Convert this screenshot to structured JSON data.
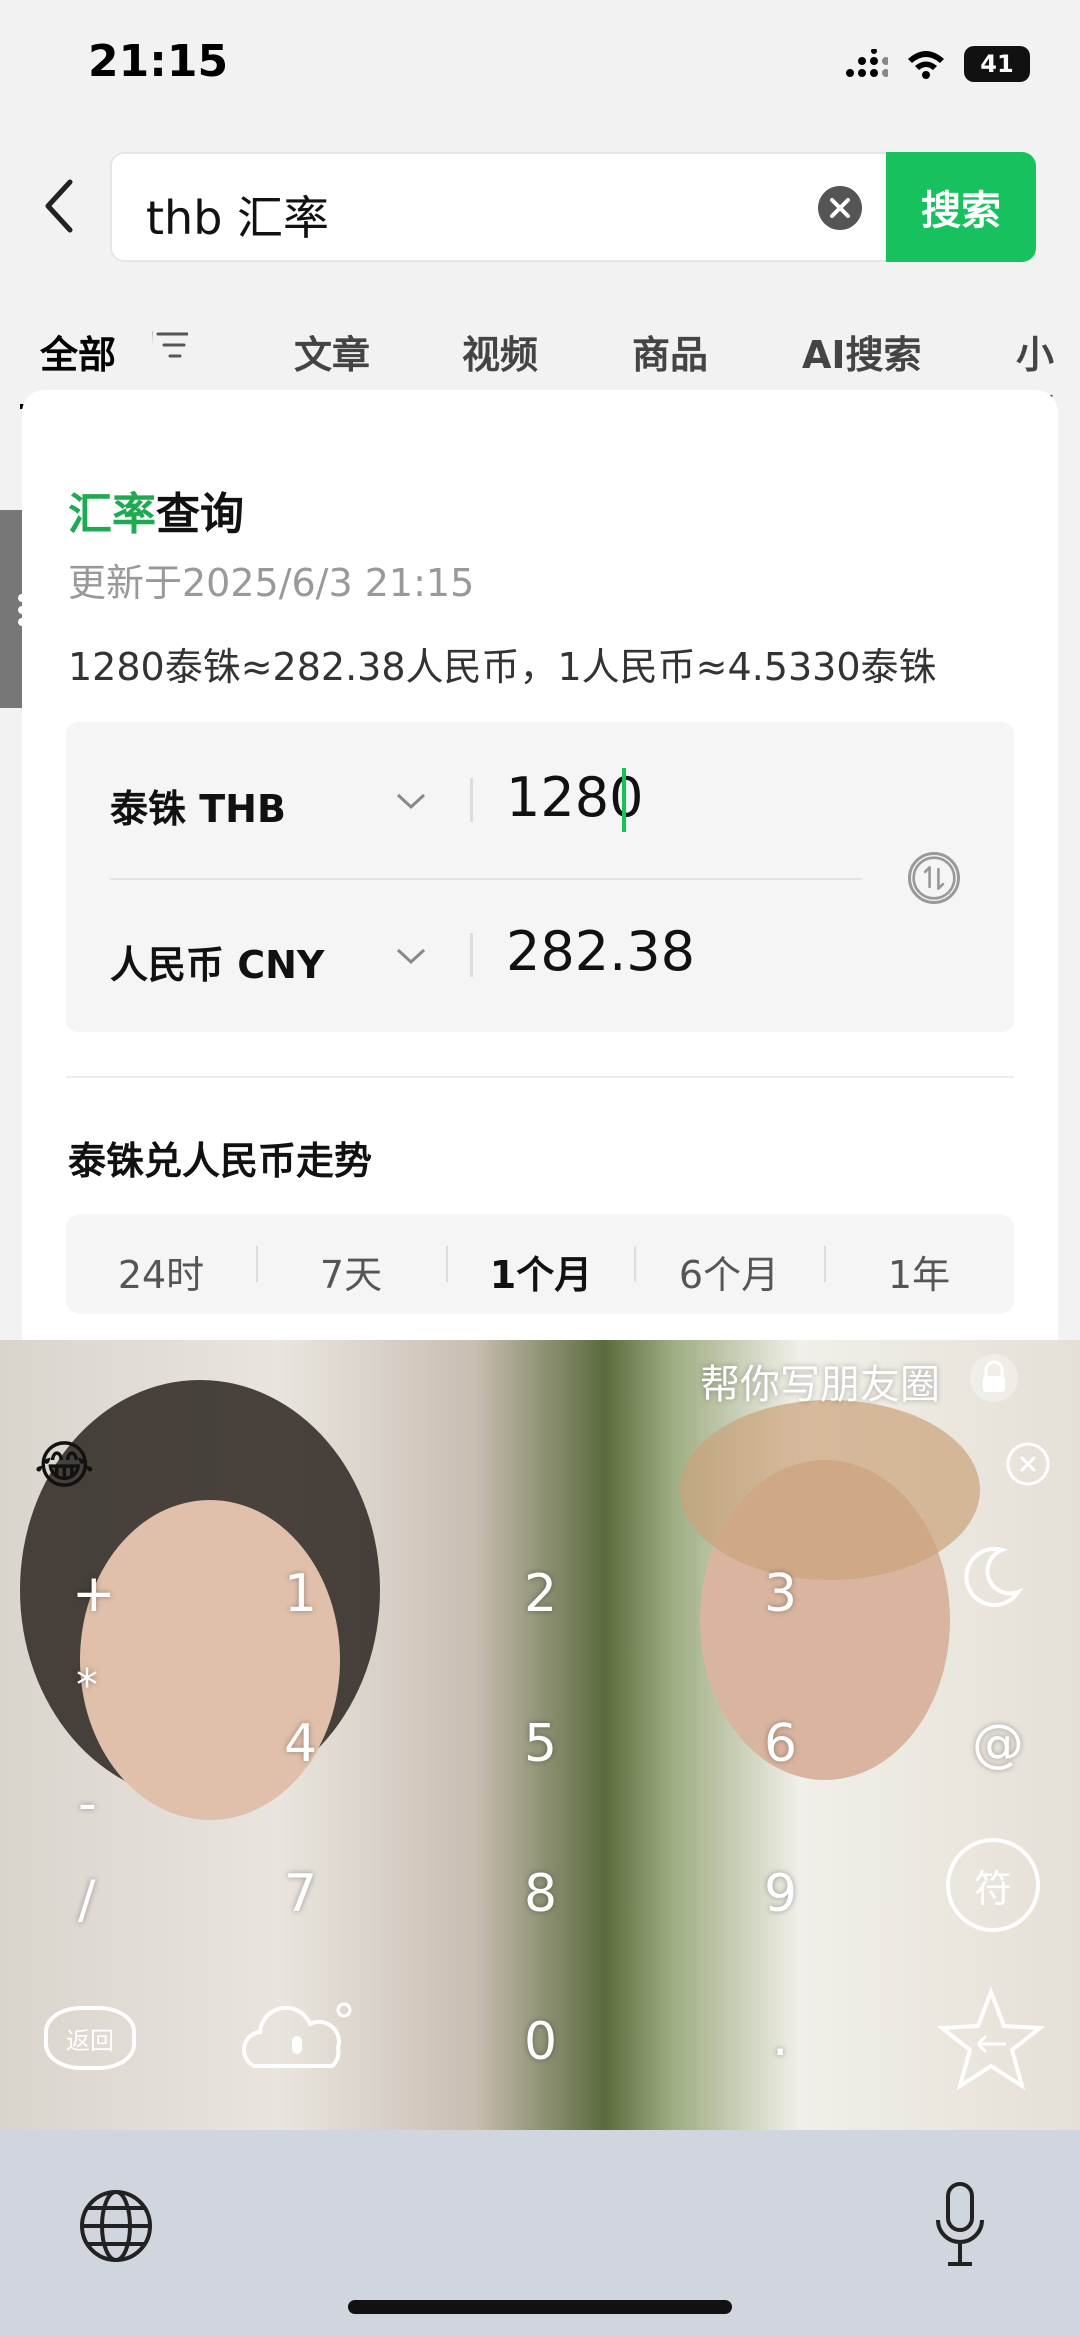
{
  "status_bar": {
    "time": "21:15",
    "battery": "41"
  },
  "search": {
    "query": "thb 汇率",
    "button_label": "搜索"
  },
  "tabs": [
    {
      "label": "全部",
      "active": true
    },
    {
      "label": "文章"
    },
    {
      "label": "视频"
    },
    {
      "label": "商品"
    },
    {
      "label": "AI搜索"
    },
    {
      "label": "小店"
    }
  ],
  "card": {
    "title_accent": "汇率",
    "title_rest": "查询",
    "updated": "更新于2025/6/3 21:15",
    "rate_summary": "1280泰铢≈282.38人民币，1人民币≈4.5330泰铢",
    "from": {
      "currency": "泰铢 THB",
      "amount": "1280"
    },
    "to": {
      "currency": "人民币 CNY",
      "amount": "282.38"
    },
    "trend_title": "泰铢兑人民币走势",
    "ranges": [
      {
        "label": "24时"
      },
      {
        "label": "7天"
      },
      {
        "label": "1个月",
        "active": true
      },
      {
        "label": "6个月"
      },
      {
        "label": "1年"
      }
    ]
  },
  "keyboard": {
    "assist_text": "帮你写朋友圈",
    "keys": {
      "plus": "+",
      "star": "*",
      "minus": "-",
      "slash": "/",
      "k1": "1",
      "k2": "2",
      "k3": "3",
      "k4": "4",
      "k5": "5",
      "k6": "6",
      "k7": "7",
      "k8": "8",
      "k9": "9",
      "k0": "0",
      "dot": ".",
      "at": "@",
      "sym": "符",
      "back": "返回"
    },
    "emoji": "😂"
  },
  "colors": {
    "accent": "#17c15d",
    "title_accent": "#1faa52"
  }
}
